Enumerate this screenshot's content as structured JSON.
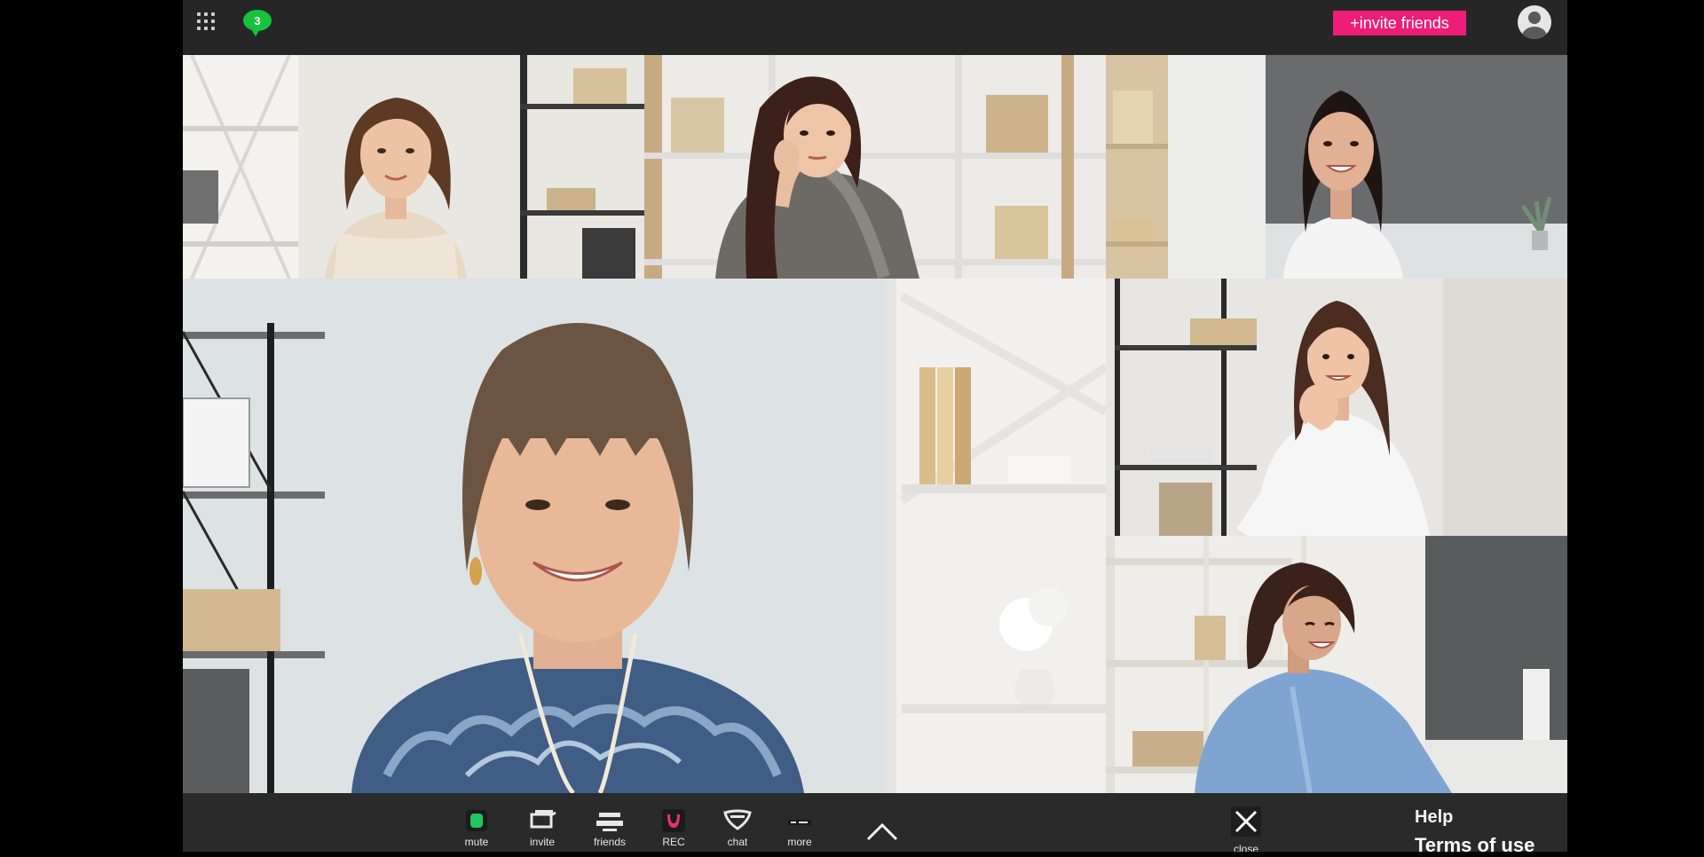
{
  "topbar": {
    "chat_count": "3",
    "invite_label": "+invite friends"
  },
  "toolbar": {
    "tools": [
      {
        "label": "mute"
      },
      {
        "label": "invite"
      },
      {
        "label": "friends"
      },
      {
        "label": "REC"
      },
      {
        "label": "chat"
      },
      {
        "label": "more"
      }
    ],
    "close_label": "close",
    "help_label": "Help",
    "terms_label": "Terms of use"
  },
  "colors": {
    "accent": "#ee1e78",
    "chat_green": "#16c23a",
    "bar_bg": "#262626"
  }
}
